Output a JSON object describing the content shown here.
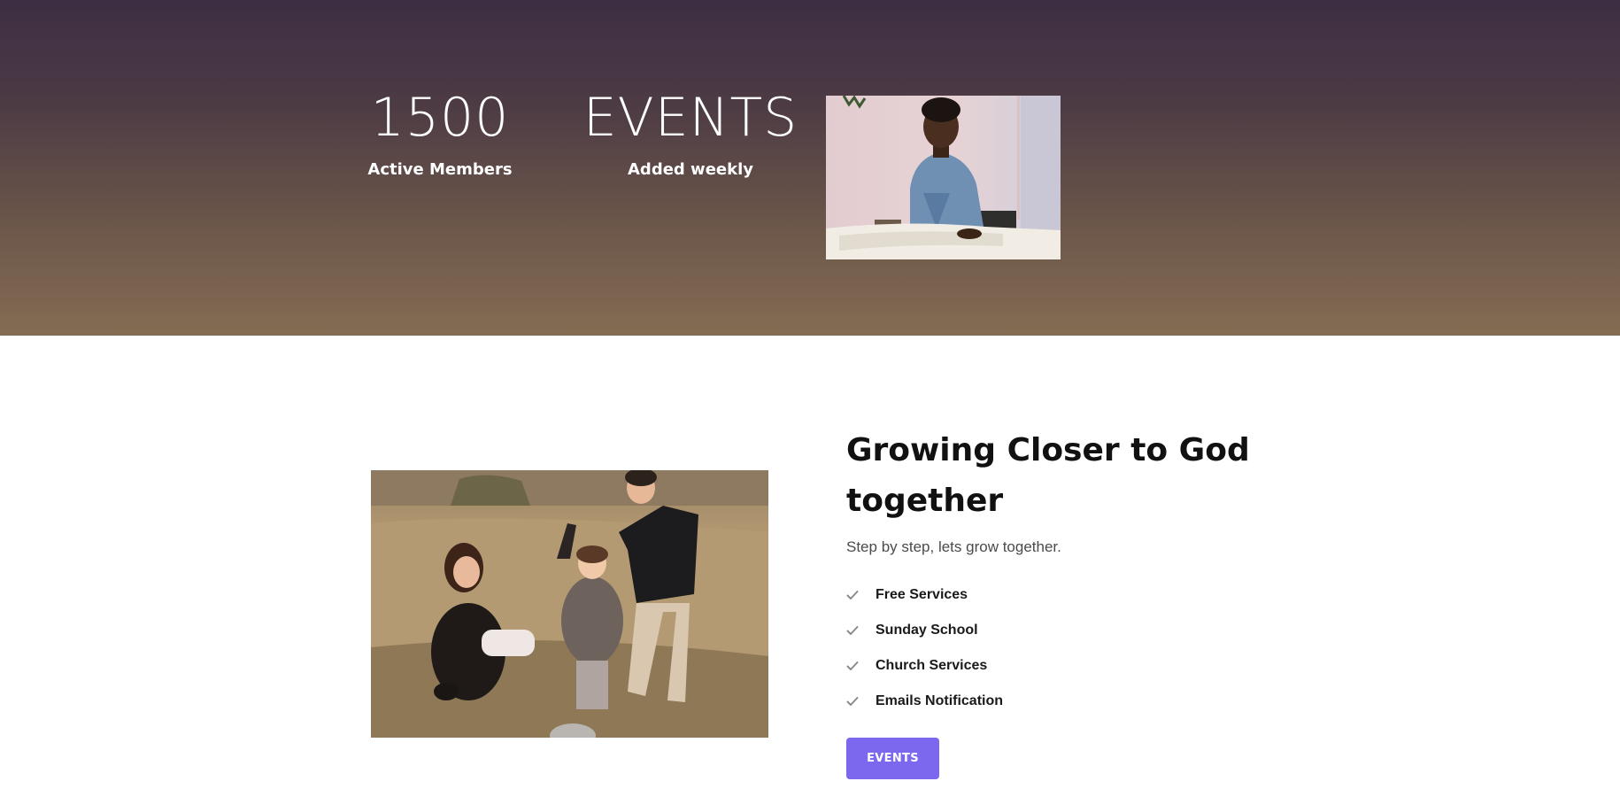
{
  "stats": [
    {
      "value": "1500",
      "label": "Active Members"
    },
    {
      "value": "EVENTS",
      "label": "Added weekly"
    }
  ],
  "feature": {
    "heading_line1": "Growing Closer to God",
    "heading_line2": "together",
    "subtitle": "Step by step, lets grow together.",
    "items": [
      {
        "label": "Free Services",
        "icon": "check-icon"
      },
      {
        "label": "Sunday School",
        "icon": "check-icon"
      },
      {
        "label": "Church Services",
        "icon": "check-icon"
      },
      {
        "label": "Emails Notification",
        "icon": "check-icon"
      }
    ],
    "button_label": "EVENTS"
  },
  "colors": {
    "hero_top": "#3d2e43",
    "hero_bottom": "#846c53",
    "accent": "#7b68ee",
    "heading": "#111111",
    "check": "#8a8a8a"
  }
}
